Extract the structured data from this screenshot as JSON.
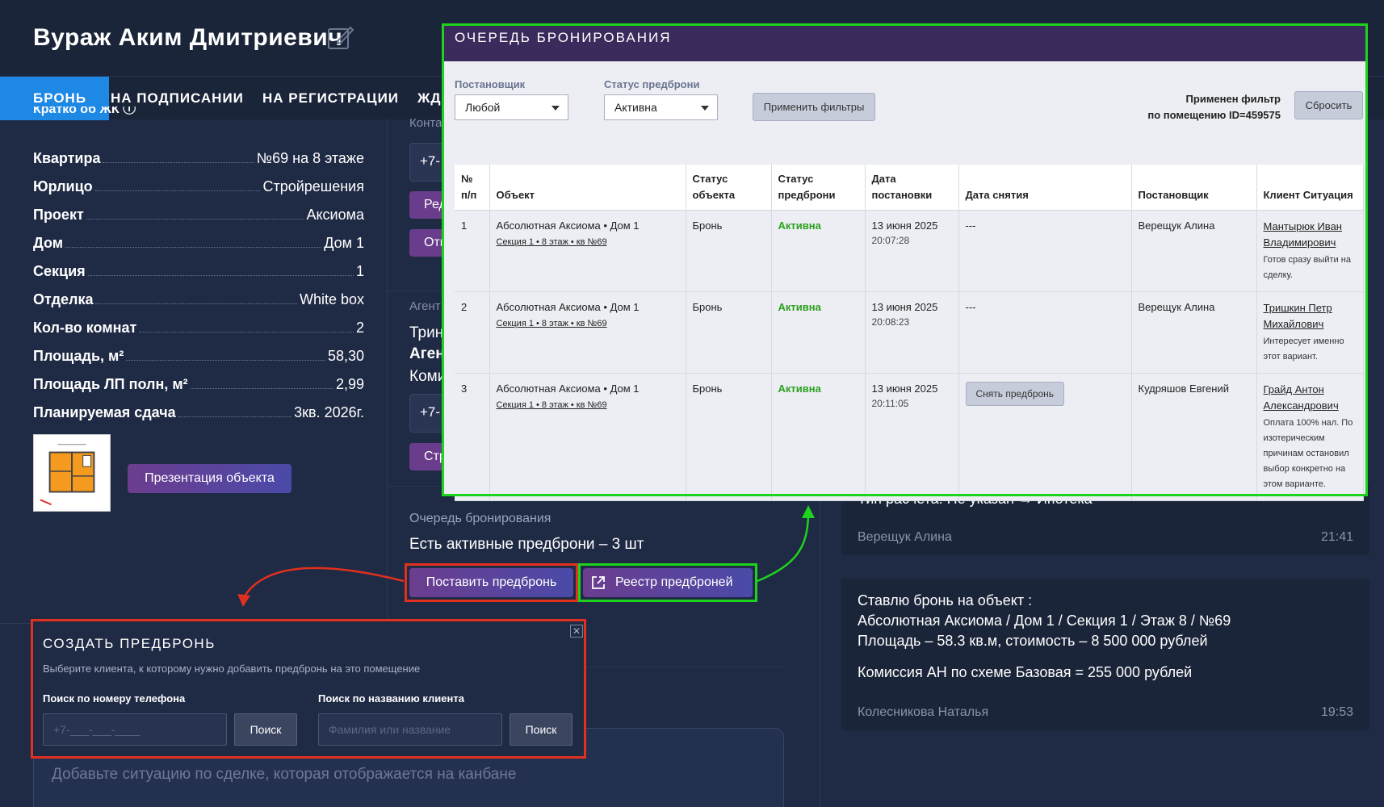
{
  "header": {
    "title": "Вураж Аким Дмитриевич"
  },
  "tabs": [
    {
      "label": "БРОНЬ",
      "active": true
    },
    {
      "label": "НА ПОДПИСАНИИ"
    },
    {
      "label": "НА РЕГИСТРАЦИИ"
    },
    {
      "label": "ЖД"
    }
  ],
  "left": {
    "cut_top": "Кратко об ЖК ⓘ",
    "params": [
      {
        "label": "Квартира",
        "value": "№69 на 8 этаже"
      },
      {
        "label": "Юрлицо",
        "value": "Стройрешения"
      },
      {
        "label": "Проект",
        "value": "Аксиома"
      },
      {
        "label": "Дом",
        "value": "Дом 1"
      },
      {
        "label": "Секция",
        "value": "1"
      },
      {
        "label": "Отделка",
        "value": "White box"
      },
      {
        "label": "Кол-во комнат",
        "value": "2"
      },
      {
        "label": "Площадь, м²",
        "value": "58,30"
      },
      {
        "label": "Площадь ЛП полн, м²",
        "value": "2,99"
      },
      {
        "label": "Планируемая сдача",
        "value": "3кв. 2026г."
      }
    ],
    "presentation_button": "Презентация объекта"
  },
  "middle": {
    "contact_label": "Конта",
    "phone1": "+7-",
    "btn_edit": "Ред",
    "btn_other": "Отп",
    "agent_label": "Агент",
    "agent_name": "Трин",
    "agency": "Аген",
    "commission": "Коми",
    "phone2": "+7-",
    "btn_str": "Стр",
    "queue_label": "Очередь бронирования",
    "queue_status": "Есть активные предброни – 3 шт",
    "set_prebook_button": "Поставить предбронь",
    "registry_button": "Реестр предброней"
  },
  "chat": [
    {
      "lines": [
        "Тип расчета: Не указан → Ипотека"
      ],
      "author": "Верещук Алина",
      "time": "21:41"
    },
    {
      "lines": [
        "Ставлю бронь на объект :",
        "Абсолютная Аксиома / Дом 1 / Секция 1 / Этаж 8 / №69",
        "Площадь – 58.3 кв.м, стоимость – 8 500 000 рублей",
        "Комиссия АН по схеме Базовая = 255 000 рублей"
      ],
      "author": "Колесникова Наталья",
      "time": "19:53"
    }
  ],
  "comment": {
    "placeholder": "Добавьте ситуацию по сделке, которая отображается на канбане"
  },
  "popup": {
    "title": "СОЗДАТЬ ПРЕДБРОНЬ",
    "subtitle": "Выберите клиента, к которому нужно добавить предбронь на это помещение",
    "phone_label": "Поиск по номеру телефона",
    "phone_placeholder": "+7-___-___-____",
    "phone_search": "Поиск",
    "name_label": "Поиск по названию клиента",
    "name_placeholder": "Фамилия или название",
    "name_search": "Поиск",
    "close": "✕"
  },
  "modal": {
    "title": "ОЧЕРЕДЬ БРОНИРОВАНИЯ",
    "filter_owner_label": "Постановщик",
    "filter_owner_value": "Любой",
    "filter_status_label": "Статус предброни",
    "filter_status_value": "Активна",
    "apply_button": "Применить фильтры",
    "filter_note_1": "Применен фильтр",
    "filter_note_2": "по помещению ID=459575",
    "reset_button": "Сбросить",
    "columns": [
      "№ п/п",
      "Объект",
      "Статус объекта",
      "Статус предброни",
      "Дата постановки",
      "Дата снятия",
      "Постановщик",
      "Клиент Ситуация"
    ],
    "rows": [
      {
        "num": "1",
        "object": "Абсолютная Аксиома • Дом 1",
        "object_sub": "Секция 1 • 8 этаж • кв №69",
        "obj_status": "Бронь",
        "pre_status": "Активна",
        "date": "13 июня 2025",
        "time": "20:07:28",
        "removed": "---",
        "owner": "Верещук Алина",
        "client": "Мантырюк Иван Владимирович",
        "note": "Готов сразу выйти на сделку."
      },
      {
        "num": "2",
        "object": "Абсолютная Аксиома • Дом 1",
        "object_sub": "Секция 1 • 8 этаж • кв №69",
        "obj_status": "Бронь",
        "pre_status": "Активна",
        "date": "13 июня 2025",
        "time": "20:08:23",
        "removed": "---",
        "owner": "Верещук Алина",
        "client": "Тришкин Петр Михайлович",
        "note": "Интересует именно этот вариант."
      },
      {
        "num": "3",
        "object": "Абсолютная Аксиома • Дом 1",
        "object_sub": "Секция 1 • 8 этаж • кв №69",
        "obj_status": "Бронь",
        "pre_status": "Активна",
        "date": "13 июня 2025",
        "time": "20:11:05",
        "removed_button": "Снять предбронь",
        "owner": "Кудряшов Евгений",
        "client": "Грайд Антон Александрович",
        "note": "Оплата 100% нал. По изотерическим причинам остановил выбор конкретно на этом варианте."
      }
    ]
  },
  "colors": {
    "background": "#1f2a44",
    "active_tab": "#1e88e5",
    "highlight_red": "#e0301e",
    "highlight_green": "#1ed31e",
    "status_active": "#2ba11c",
    "modal_header": "#3b2a5c"
  }
}
